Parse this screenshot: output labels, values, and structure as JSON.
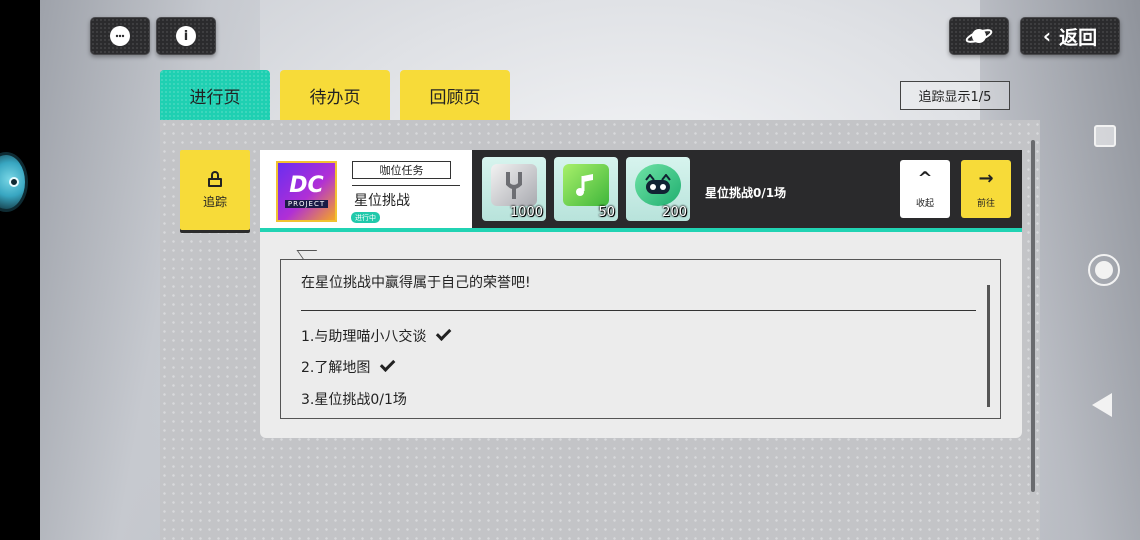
{
  "header": {
    "chat_icon": "chat-bubble-icon",
    "info_icon": "info-icon",
    "planet_icon": "planet-icon",
    "back_label": "返回"
  },
  "tabs": [
    {
      "label": "进行页",
      "active": true
    },
    {
      "label": "待办页",
      "active": false
    },
    {
      "label": "回顾页",
      "active": false
    }
  ],
  "tracking": {
    "display_label": "追踪显示1/5"
  },
  "track_button": {
    "label": "追踪"
  },
  "quest": {
    "logo_text": "DC",
    "logo_sub": "PROJECT",
    "type": "咖位任务",
    "name": "星位挑战",
    "status": "进行中",
    "progress": "星位挑战0/1场",
    "rewards": [
      {
        "icon": "tuning-fork-icon",
        "qty": "1000"
      },
      {
        "icon": "music-cube-icon",
        "qty": "50"
      },
      {
        "icon": "cat-token-icon",
        "qty": "200"
      }
    ],
    "collapse_label": "收起",
    "go_label": "前往"
  },
  "detail": {
    "description": "在星位挑战中赢得属于自己的荣誉吧!",
    "steps": [
      {
        "text": "1.与助理喵小八交谈",
        "done": true
      },
      {
        "text": "2.了解地图",
        "done": true
      },
      {
        "text": "3.星位挑战0/1场",
        "done": false
      }
    ]
  },
  "colors": {
    "accent_teal": "#21d3b3",
    "accent_yellow": "#f7db39",
    "dark": "#2a2a2c"
  }
}
